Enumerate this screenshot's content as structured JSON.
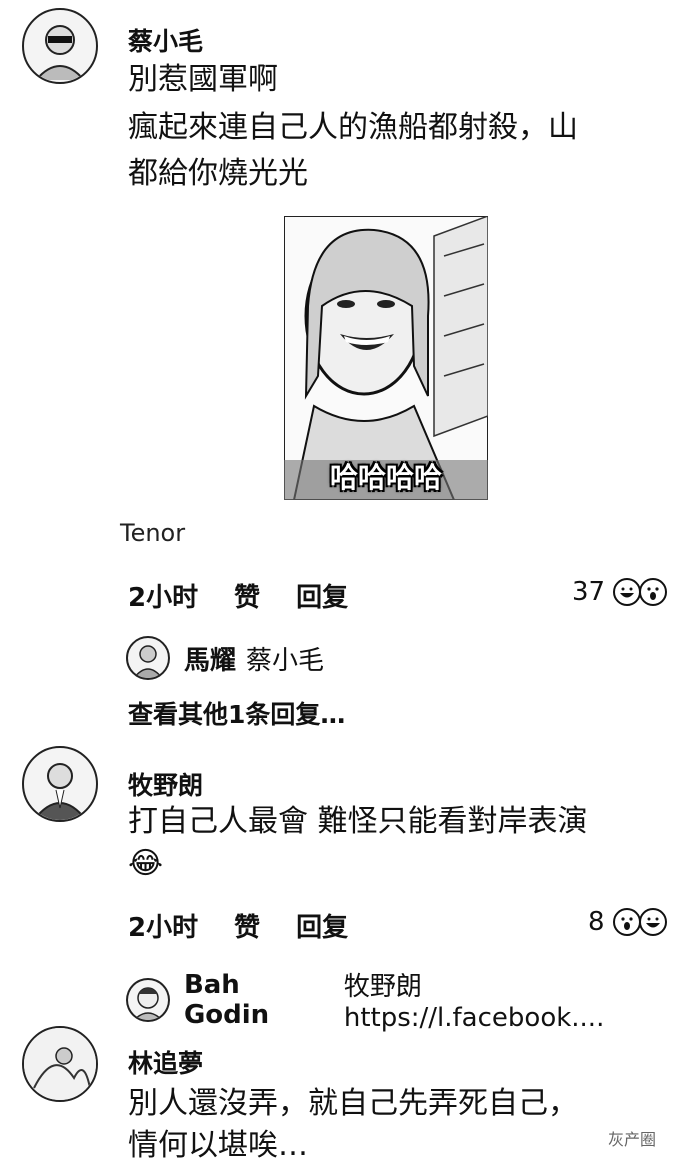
{
  "comments": [
    {
      "author": "蔡小毛",
      "lines": [
        "別惹國軍啊",
        "瘋起來連自己人的漁船都射殺，山",
        "都給你燒光光"
      ],
      "gif_caption": "哈哈哈哈",
      "gif_source": "Tenor",
      "time": "2小时",
      "like_label": "赞",
      "reply_label": "回复",
      "reaction_count": "37",
      "reaction_icons": [
        "laugh-icon",
        "wow-icon"
      ],
      "reply": {
        "author": "馬耀",
        "text": "蔡小毛"
      },
      "more_replies": "查看其他1条回复…"
    },
    {
      "author": "牧野朗",
      "lines": [
        "打自己人最會 難怪只能看對岸表演"
      ],
      "emoji": "😂",
      "time": "2小时",
      "like_label": "赞",
      "reply_label": "回复",
      "reaction_count": "8",
      "reaction_icons": [
        "wow-icon",
        "laugh-icon"
      ],
      "reply": {
        "author": "Bah Godin",
        "text": "牧野朗 https://l.facebook...."
      }
    },
    {
      "author": "林追夢",
      "lines": [
        "別人還沒弄，就自己先弄死自己，",
        "情何以堪唉…"
      ]
    }
  ],
  "watermark": "灰产圈"
}
